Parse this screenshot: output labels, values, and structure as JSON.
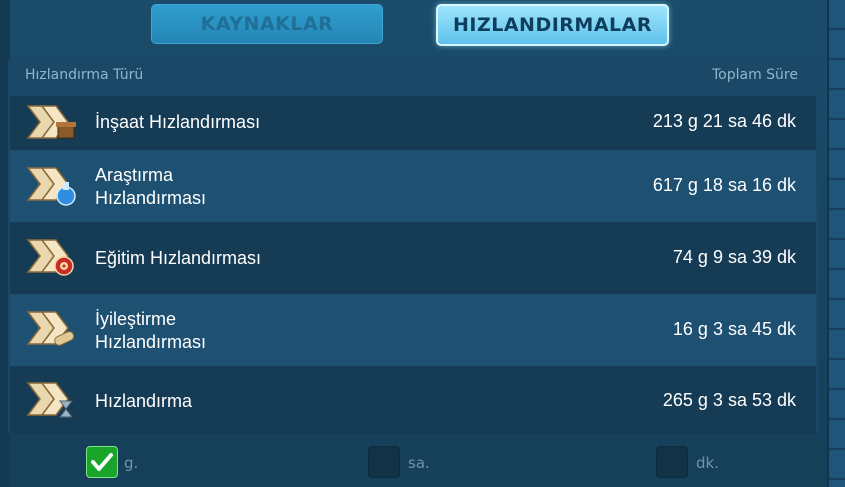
{
  "tabs": [
    {
      "label": "KAYNAKLAR",
      "active": false
    },
    {
      "label": "HIZLANDIRMALAR",
      "active": true
    }
  ],
  "table": {
    "header_type": "Hızlandırma Türü",
    "header_total": "Toplam Süre",
    "rows": [
      {
        "label": "İnşaat Hızlandırması",
        "total": "213 g 21 sa 46 dk",
        "icon": "construction-speedup-icon"
      },
      {
        "label": "Araştırma\nHızlandırması",
        "total": "617 g 18 sa 16 dk",
        "icon": "research-speedup-icon"
      },
      {
        "label": "Eğitim Hızlandırması",
        "total": "74 g 9 sa 39 dk",
        "icon": "training-speedup-icon"
      },
      {
        "label": "İyileştirme\nHızlandırması",
        "total": "16 g 3 sa 45 dk",
        "icon": "healing-speedup-icon"
      },
      {
        "label": "Hızlandırma",
        "total": "265 g 3 sa 53 dk",
        "icon": "universal-speedup-icon"
      }
    ]
  },
  "units": [
    {
      "label": "g.",
      "checked": true
    },
    {
      "label": "sa.",
      "checked": false
    },
    {
      "label": "dk.",
      "checked": false
    }
  ],
  "colors": {
    "accent": "#5fc2ec",
    "check_on": "#18a52a"
  }
}
